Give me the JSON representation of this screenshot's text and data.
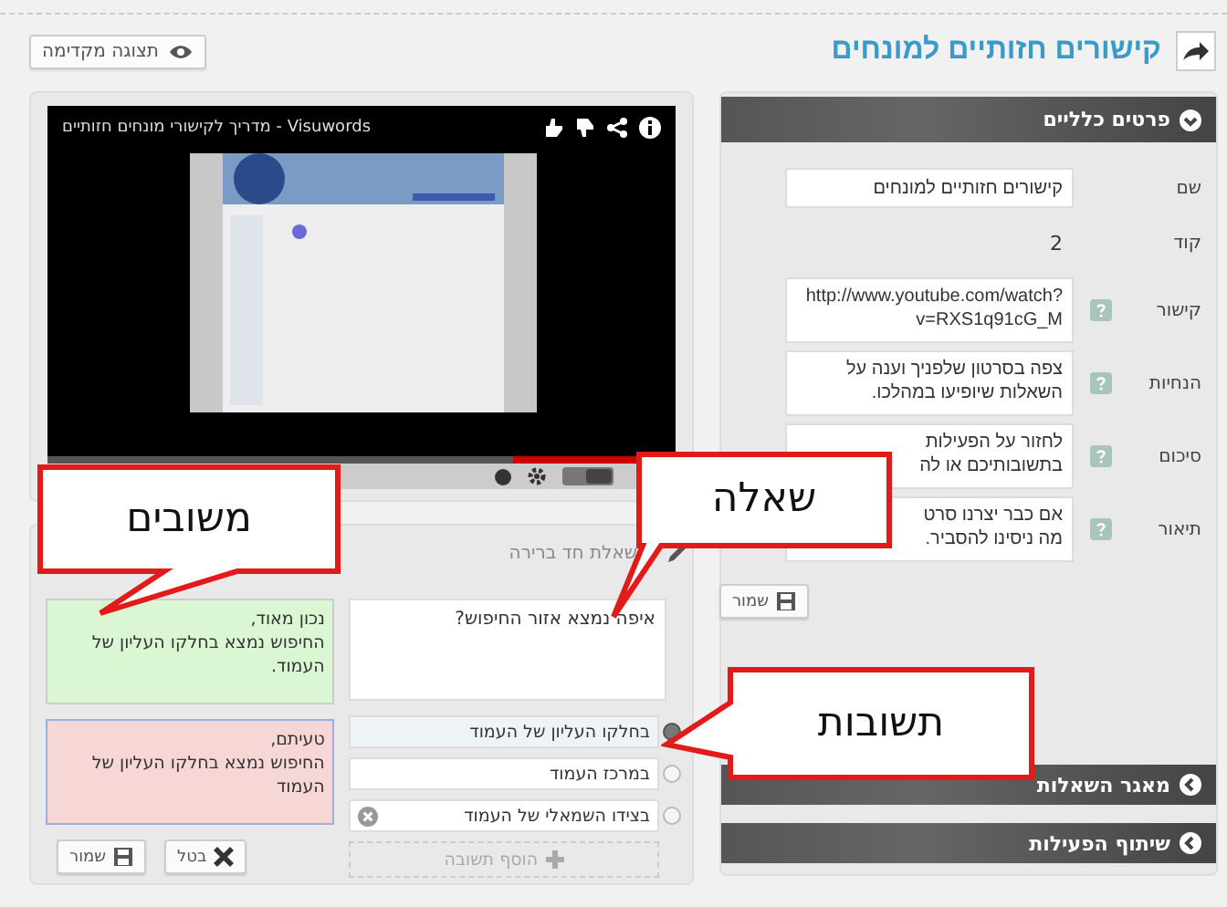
{
  "header": {
    "title": "קישורים חזותיים למונחים",
    "preview_button": "תצוגה מקדימה"
  },
  "video": {
    "title": "Visuwords - מדריך לקישורי מונחים חזותיים",
    "level": 0.26
  },
  "details": {
    "title": "פרטים כלליים",
    "expanded": true,
    "fields": [
      {
        "label": "שם",
        "kind": "input",
        "value": "קישורים חזותיים למונחים",
        "help": false
      },
      {
        "label": "קוד",
        "kind": "text",
        "value": "2",
        "help": false
      },
      {
        "label": "קישור",
        "kind": "textarea",
        "value": "http://www.youtube.com/watch?v=RXS1q91cG_M",
        "help": true
      },
      {
        "label": "הנחיות",
        "kind": "textarea",
        "value": "צפה בסרטון שלפניך וענה על השאלות שיופיעו במהלכו.",
        "help": true
      },
      {
        "label": "סיכום",
        "kind": "textarea",
        "value": "לחזור על הפעילות\nבתשובותיכם או לה",
        "help": true
      },
      {
        "label": "תיאור",
        "kind": "textarea",
        "value": "אם כבר יצרנו סרט\nמה ניסינו להסביר.",
        "help": true
      }
    ],
    "save": "שמור"
  },
  "sections": [
    {
      "title": "מאגר השאלות",
      "expanded": false
    },
    {
      "title": "שיתוף הפעילות",
      "expanded": false
    }
  ],
  "question": {
    "type_label": "שאלת חד ברירה",
    "text": "איפה נמצא אזור החיפוש?",
    "answers": [
      {
        "text": "בחלקו העליון של העמוד",
        "selected": true,
        "removable": false
      },
      {
        "text": "במרכז העמוד",
        "selected": false,
        "removable": false
      },
      {
        "text": "בצידו השמאלי של העמוד",
        "selected": false,
        "removable": true
      }
    ],
    "add_answer": "הוסף תשובה",
    "feedback": [
      {
        "kind": "correct",
        "text": "נכון מאוד,\nהחיפוש נמצא בחלקו העליון של העמוד."
      },
      {
        "kind": "wrong",
        "text": "טעיתם,\nהחיפוש נמצא בחלקו העליון של העמוד"
      }
    ],
    "buttons": [
      {
        "kind": "cancel",
        "label": "בטל"
      },
      {
        "kind": "save",
        "label": "שמור"
      }
    ]
  },
  "callouts": [
    {
      "text": "משובים"
    },
    {
      "text": "שאלה"
    },
    {
      "text": "תשובות"
    }
  ]
}
